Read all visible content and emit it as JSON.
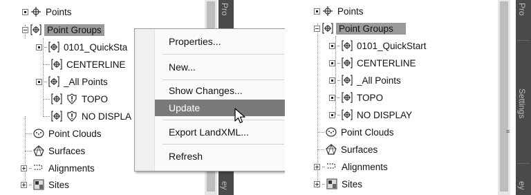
{
  "left_panel": {
    "tree": {
      "points": "Points",
      "point_groups": "Point Groups",
      "quickstart": "0101_QuickSta",
      "centerline": "CENTERLINE",
      "all_points": "_All Points",
      "topo": "TOPO",
      "no_display": "NO DISPLA",
      "point_clouds": "Point Clouds",
      "surfaces": "Surfaces",
      "alignments": "Alignments",
      "sites": "Sites"
    },
    "side_tab_top": "Pro",
    "side_tab_bottom": "ey"
  },
  "context_menu": {
    "properties": "Properties...",
    "new": "New...",
    "show_changes": "Show Changes...",
    "update": "Update",
    "export_landxml": "Export LandXML...",
    "refresh": "Refresh"
  },
  "right_panel": {
    "tree": {
      "points": "Points",
      "point_groups": "Point Groups",
      "quickstart": "0101_QuickStart",
      "centerline": "CENTERLINE",
      "all_points": "_All Points",
      "topo": "TOPO",
      "no_display": "NO DISPLAY",
      "point_clouds": "Point Clouds",
      "surfaces": "Surfaces",
      "alignments": "Alignments",
      "sites": "Sites"
    },
    "side_tab_top": "Pro",
    "side_tab_middle": "Settings",
    "side_tab_bottom": "ey"
  },
  "colors": {
    "selection": "#9a9a9a",
    "menu_highlight": "#7a7a7a",
    "side_tab": "#4a4a4a"
  }
}
